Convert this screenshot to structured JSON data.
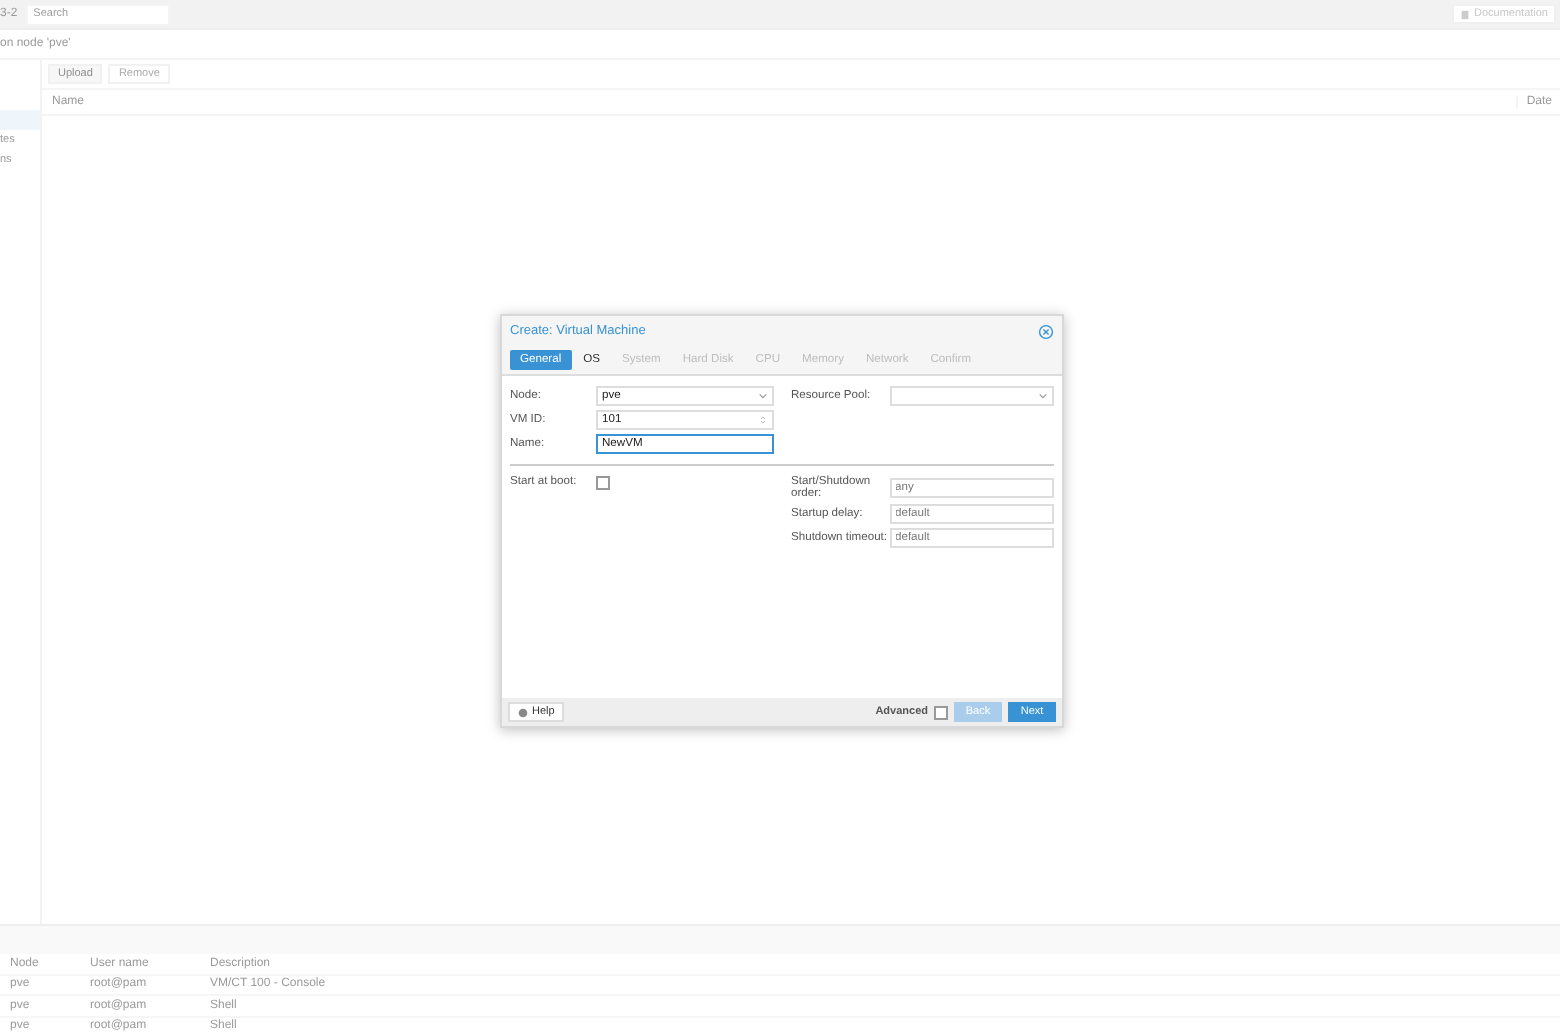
{
  "topbar": {
    "version": "3-2",
    "search": {
      "placeholder": "Search"
    },
    "documentation": "Documentation"
  },
  "breadcrumb": "on node 'pve'",
  "sidebar": {
    "items": [
      {
        "selected": true
      },
      {
        "label": "tes",
        "selected": false
      },
      {
        "label": "ns",
        "selected": false
      }
    ]
  },
  "toolbar": {
    "buttons": [
      {
        "label": "Upload",
        "disabled": false
      },
      {
        "label": "Remove",
        "disabled": true
      }
    ]
  },
  "grid": {
    "columns": [
      "Name",
      "Date"
    ]
  },
  "tasks": {
    "columns": [
      "Node",
      "User name",
      "Description"
    ],
    "rows": [
      [
        "pve",
        "root@pam",
        "VM/CT 100 - Console"
      ],
      [
        "pve",
        "root@pam",
        "Shell"
      ],
      [
        "pve",
        "root@pam",
        "Shell"
      ]
    ]
  },
  "dialog": {
    "title": "Create: Virtual Machine",
    "tabs": [
      {
        "label": "General",
        "selected": true,
        "disabled": false
      },
      {
        "label": "OS",
        "selected": false,
        "disabled": false
      },
      {
        "label": "System",
        "selected": false,
        "disabled": true
      },
      {
        "label": "Hard Disk",
        "selected": false,
        "disabled": true
      },
      {
        "label": "CPU",
        "selected": false,
        "disabled": true
      },
      {
        "label": "Memory",
        "selected": false,
        "disabled": true
      },
      {
        "label": "Network",
        "selected": false,
        "disabled": true
      },
      {
        "label": "Confirm",
        "selected": false,
        "disabled": true
      }
    ],
    "left_fields": [
      {
        "label": "Node:",
        "kind": "select",
        "value": "pve"
      },
      {
        "label": "VM ID:",
        "kind": "spinner",
        "value": "101"
      },
      {
        "label": "Name:",
        "kind": "text",
        "value": "NewVM",
        "focused": true
      }
    ],
    "right_fields": [
      {
        "label": "Resource Pool:",
        "kind": "select"
      }
    ],
    "start_at_boot": {
      "label": "Start at boot:",
      "checked": false
    },
    "order_fields": [
      {
        "label": "Start/Shutdown order:",
        "placeholder": "any"
      },
      {
        "label": "Startup delay:",
        "placeholder": "default"
      },
      {
        "label": "Shutdown timeout:",
        "placeholder": "default"
      }
    ],
    "footer": {
      "help": "Help",
      "advanced": {
        "label": "Advanced",
        "checked": false
      },
      "buttons": [
        {
          "label": "Back",
          "disabled": true
        },
        {
          "label": "Next",
          "disabled": false
        }
      ]
    }
  }
}
